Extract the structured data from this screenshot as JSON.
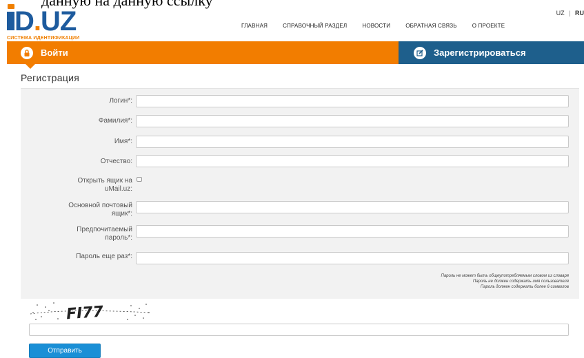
{
  "top_overflow_text": "данную на данную ссылку",
  "logo": {
    "title_rest": "D",
    "title_dot": ".",
    "title_end": "UZ",
    "subtitle": "СИСТЕМА ИДЕНТИФИКАЦИИ"
  },
  "language": {
    "uz": "UZ",
    "separator": "|",
    "ru": "RU"
  },
  "nav": {
    "items": [
      {
        "label": "ГЛАВНАЯ"
      },
      {
        "label": "СПРАВОЧНЫЙ РАЗДЕЛ"
      },
      {
        "label": "НОВОСТИ"
      },
      {
        "label": "ОБРАТНАЯ СВЯЗЬ"
      },
      {
        "label": "О ПРОЕКТЕ"
      }
    ]
  },
  "tabs": {
    "login_label": "Войти",
    "register_label": "Зарегистрироваться",
    "login_icon": "lock-icon",
    "register_icon": "edit-icon"
  },
  "colors": {
    "brand_blue": "#1d5b9e",
    "brand_orange": "#f07f00",
    "login_tab": "#f27d00",
    "register_tab": "#1e5f8c",
    "submit_button": "#1a8fd6"
  },
  "form": {
    "title": "Регистрация",
    "fields": {
      "login": {
        "label": "Логин*:",
        "value": ""
      },
      "surname": {
        "label": "Фамилия*:",
        "value": ""
      },
      "name": {
        "label": "Имя*:",
        "value": ""
      },
      "patronymic": {
        "label": "Отчество:",
        "value": ""
      },
      "open_mailbox": {
        "label_line1": "Открыть ящик на",
        "label_line2": "uMail.uz:",
        "checked": false
      },
      "main_email": {
        "label_line1": "Основной почтовый",
        "label_line2": "ящик*:",
        "value": ""
      },
      "password": {
        "label_line1": "Предпочитаемый",
        "label_line2": "пароль*:",
        "value": ""
      },
      "password_repeat": {
        "label": "Пароль еще раз*:",
        "value": ""
      }
    },
    "hints": {
      "line1": "Пароль не может быть общеупотребляемым словом из словаря",
      "line2": "Пароль не должен содержать имя пользователя",
      "line3": "Пароль должен содержать более 6 символов"
    },
    "captcha": {
      "text": "FI77",
      "input_value": ""
    },
    "submit_label": "Отправить"
  }
}
